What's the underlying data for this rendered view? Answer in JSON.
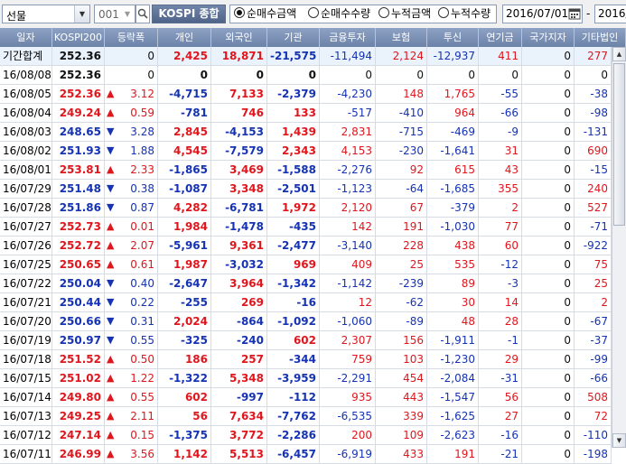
{
  "toolbar": {
    "market_select": "선물",
    "code_value": "001",
    "index_button": "KOSPI 종합",
    "radio_options": [
      {
        "label": "순매수금액",
        "selected": true
      },
      {
        "label": "순매수수량",
        "selected": false
      },
      {
        "label": "누적금액",
        "selected": false
      },
      {
        "label": "누적수량",
        "selected": false
      }
    ],
    "date_from": "2016/07/01",
    "date_sep": "-",
    "date_to": "2016/"
  },
  "colors": {
    "up": "#e0161d",
    "down": "#1533b3",
    "header_bg": "#7b90b4",
    "summary_bg": "#eaf2fb"
  },
  "columns": [
    "일자",
    "KOSPI200",
    "등락폭",
    "개인",
    "외국인",
    "기관",
    "금융투자",
    "보험",
    "투신",
    "연기금",
    "국가지자",
    "기타법인"
  ],
  "summary": {
    "date": "기간합계",
    "kospi": "252.36",
    "change": "0",
    "values": [
      "2,425",
      "18,871",
      "-21,575",
      "-11,494",
      "2,124",
      "-12,937",
      "411",
      "0",
      "277"
    ]
  },
  "rows": [
    {
      "date": "16/08/08",
      "kospi": "252.36",
      "dir": "none",
      "change": "0",
      "values": [
        "0",
        "0",
        "0",
        "0",
        "0",
        "0",
        "0",
        "0",
        "0"
      ]
    },
    {
      "date": "16/08/05",
      "kospi": "252.36",
      "dir": "up",
      "change": "3.12",
      "values": [
        "-4,715",
        "7,133",
        "-2,379",
        "-4,230",
        "148",
        "1,765",
        "-55",
        "0",
        "-38"
      ]
    },
    {
      "date": "16/08/04",
      "kospi": "249.24",
      "dir": "up",
      "change": "0.59",
      "values": [
        "-781",
        "746",
        "133",
        "-517",
        "-410",
        "964",
        "-66",
        "0",
        "-98"
      ]
    },
    {
      "date": "16/08/03",
      "kospi": "248.65",
      "dir": "down",
      "change": "3.28",
      "values": [
        "2,845",
        "-4,153",
        "1,439",
        "2,831",
        "-715",
        "-469",
        "-9",
        "0",
        "-131"
      ]
    },
    {
      "date": "16/08/02",
      "kospi": "251.93",
      "dir": "down",
      "change": "1.88",
      "values": [
        "4,545",
        "-7,579",
        "2,343",
        "4,153",
        "-230",
        "-1,641",
        "31",
        "0",
        "690"
      ]
    },
    {
      "date": "16/08/01",
      "kospi": "253.81",
      "dir": "up",
      "change": "2.33",
      "values": [
        "-1,865",
        "3,469",
        "-1,588",
        "-2,276",
        "92",
        "615",
        "43",
        "0",
        "-15"
      ]
    },
    {
      "date": "16/07/29",
      "kospi": "251.48",
      "dir": "down",
      "change": "0.38",
      "values": [
        "-1,087",
        "3,348",
        "-2,501",
        "-1,123",
        "-64",
        "-1,685",
        "355",
        "0",
        "240"
      ]
    },
    {
      "date": "16/07/28",
      "kospi": "251.86",
      "dir": "down",
      "change": "0.87",
      "values": [
        "4,282",
        "-6,781",
        "1,972",
        "2,120",
        "67",
        "-379",
        "2",
        "0",
        "527"
      ]
    },
    {
      "date": "16/07/27",
      "kospi": "252.73",
      "dir": "up",
      "change": "0.01",
      "values": [
        "1,984",
        "-1,478",
        "-435",
        "142",
        "191",
        "-1,030",
        "77",
        "0",
        "-71"
      ]
    },
    {
      "date": "16/07/26",
      "kospi": "252.72",
      "dir": "up",
      "change": "2.07",
      "values": [
        "-5,961",
        "9,361",
        "-2,477",
        "-3,140",
        "228",
        "438",
        "60",
        "0",
        "-922"
      ]
    },
    {
      "date": "16/07/25",
      "kospi": "250.65",
      "dir": "up",
      "change": "0.61",
      "values": [
        "1,987",
        "-3,032",
        "969",
        "409",
        "25",
        "535",
        "-12",
        "0",
        "75"
      ]
    },
    {
      "date": "16/07/22",
      "kospi": "250.04",
      "dir": "down",
      "change": "0.40",
      "values": [
        "-2,647",
        "3,964",
        "-1,342",
        "-1,142",
        "-239",
        "89",
        "-3",
        "0",
        "25"
      ]
    },
    {
      "date": "16/07/21",
      "kospi": "250.44",
      "dir": "down",
      "change": "0.22",
      "values": [
        "-255",
        "269",
        "-16",
        "12",
        "-62",
        "30",
        "14",
        "0",
        "2"
      ]
    },
    {
      "date": "16/07/20",
      "kospi": "250.66",
      "dir": "down",
      "change": "0.31",
      "values": [
        "2,024",
        "-864",
        "-1,092",
        "-1,060",
        "-89",
        "48",
        "28",
        "0",
        "-67"
      ]
    },
    {
      "date": "16/07/19",
      "kospi": "250.97",
      "dir": "down",
      "change": "0.55",
      "values": [
        "-325",
        "-240",
        "602",
        "2,307",
        "156",
        "-1,911",
        "-1",
        "0",
        "-37"
      ]
    },
    {
      "date": "16/07/18",
      "kospi": "251.52",
      "dir": "up",
      "change": "0.50",
      "values": [
        "186",
        "257",
        "-344",
        "759",
        "103",
        "-1,230",
        "29",
        "0",
        "-99"
      ]
    },
    {
      "date": "16/07/15",
      "kospi": "251.02",
      "dir": "up",
      "change": "1.22",
      "values": [
        "-1,322",
        "5,348",
        "-3,959",
        "-2,291",
        "454",
        "-2,084",
        "-31",
        "0",
        "-66"
      ]
    },
    {
      "date": "16/07/14",
      "kospi": "249.80",
      "dir": "up",
      "change": "0.55",
      "values": [
        "602",
        "-997",
        "-112",
        "935",
        "443",
        "-1,547",
        "56",
        "0",
        "508"
      ]
    },
    {
      "date": "16/07/13",
      "kospi": "249.25",
      "dir": "up",
      "change": "2.11",
      "values": [
        "56",
        "7,634",
        "-7,762",
        "-6,535",
        "339",
        "-1,625",
        "27",
        "0",
        "72"
      ]
    },
    {
      "date": "16/07/12",
      "kospi": "247.14",
      "dir": "up",
      "change": "0.15",
      "values": [
        "-1,375",
        "3,772",
        "-2,286",
        "200",
        "109",
        "-2,623",
        "-16",
        "0",
        "-110"
      ]
    },
    {
      "date": "16/07/11",
      "kospi": "246.99",
      "dir": "up",
      "change": "3.56",
      "values": [
        "1,142",
        "5,513",
        "-6,457",
        "-6,919",
        "433",
        "191",
        "-21",
        "0",
        "-198"
      ]
    }
  ]
}
